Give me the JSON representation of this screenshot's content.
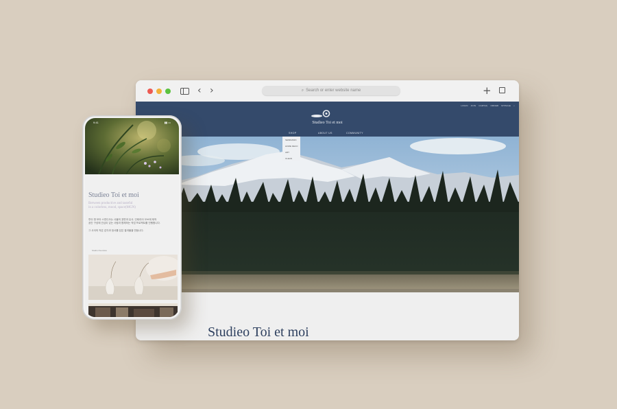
{
  "browser": {
    "search": {
      "placeholder": "Search or enter website name"
    },
    "icons": [
      "sidebar-icon",
      "back-arrow-icon",
      "forward-arrow-icon",
      "search-icon",
      "new-tab-plus-icon",
      "tabs-overview-icon"
    ]
  },
  "site": {
    "util_links": [
      "LOGIN",
      "JOIN",
      "CART(0)",
      "ORDER",
      "MYPAGE"
    ],
    "logo_text": "Studieo Toi et moi",
    "nav": [
      "SHOP",
      "ABOUT US",
      "COMMUNITY"
    ],
    "dropdown": [
      "SEMIDAWN",
      "HOME DECO",
      "ART",
      "CLEAN"
    ],
    "hero_alt": "mountain landscape",
    "title": "Studieo Toi et moi"
  },
  "mobile": {
    "status": {
      "time": "9:41"
    },
    "title": "Studieo Toi et moi",
    "subtitle_lines": [
      "Between productive and tasteful",
      "in a colorless, mood, space(MGN)"
    ],
    "body_p1": [
      "투이 앤 모아 스튜디오는 사물의 표면과 유사, 인테리어 오브제 제작",
      "공간 구성에 관심이 있는 사람과 함께하는 작업 프로젝트를 진행합니다."
    ],
    "body_p2": [
      "그 사이의 작은 감각과 정서를 담은 결과물을 만듭니다."
    ],
    "button_label": "Studio Overview"
  },
  "colors": {
    "background": "#d9cebf",
    "header_navy": "#344a6b",
    "title_navy": "#2d3f5e"
  }
}
